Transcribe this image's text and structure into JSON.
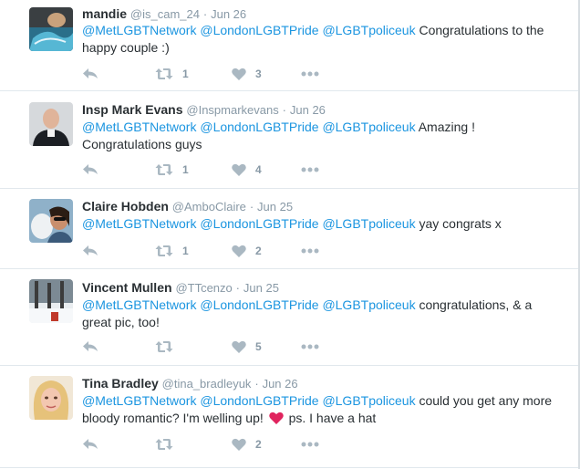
{
  "tweets": [
    {
      "name": "mandie",
      "handle": "@is_cam_24",
      "dot": "·",
      "time": "Jun 26",
      "mentions": [
        "@MetLGBTNetwork",
        "@LondonLGBTPride",
        "@LGBTpoliceuk"
      ],
      "text": "Congratulations to the happy couple :)",
      "retweets": "1",
      "likes": "3"
    },
    {
      "name": "Insp Mark Evans",
      "handle": "@Inspmarkevans",
      "dot": "·",
      "time": "Jun 26",
      "mentions": [
        "@MetLGBTNetwork",
        "@LondonLGBTPride",
        "@LGBTpoliceuk"
      ],
      "text": "Amazing ! Congratulations guys",
      "retweets": "1",
      "likes": "4"
    },
    {
      "name": "Claire Hobden",
      "handle": "@AmboClaire",
      "dot": "·",
      "time": "Jun 25",
      "mentions": [
        "@MetLGBTNetwork",
        "@LondonLGBTPride",
        "@LGBTpoliceuk"
      ],
      "text": "yay congrats x",
      "retweets": "1",
      "likes": "2"
    },
    {
      "name": "Vincent Mullen",
      "handle": "@TTcenzo",
      "dot": "·",
      "time": "Jun 25",
      "mentions": [
        "@MetLGBTNetwork",
        "@LondonLGBTPride",
        "@LGBTpoliceuk"
      ],
      "text": "congratulations, & a great pic, too!",
      "retweets": "",
      "likes": "5"
    },
    {
      "name": "Tina Bradley",
      "handle": "@tina_bradleyuk",
      "dot": "·",
      "time": "Jun 26",
      "mentions": [
        "@MetLGBTNetwork",
        "@LondonLGBTPride",
        "@LGBTpoliceuk"
      ],
      "text": "could you get any more bloody romantic? I'm welling up!",
      "text_after_emoji": "ps. I have a hat",
      "retweets": "",
      "likes": "2"
    }
  ],
  "colors": {
    "link": "#1b95e0",
    "muted": "#8899a6",
    "text": "#292f33",
    "separator": "#e1e8ed",
    "emoji_heart": "#e0245e"
  },
  "icons": {
    "reply": "reply-icon",
    "retweet": "retweet-icon",
    "like": "heart-icon",
    "more": "more-icon"
  }
}
